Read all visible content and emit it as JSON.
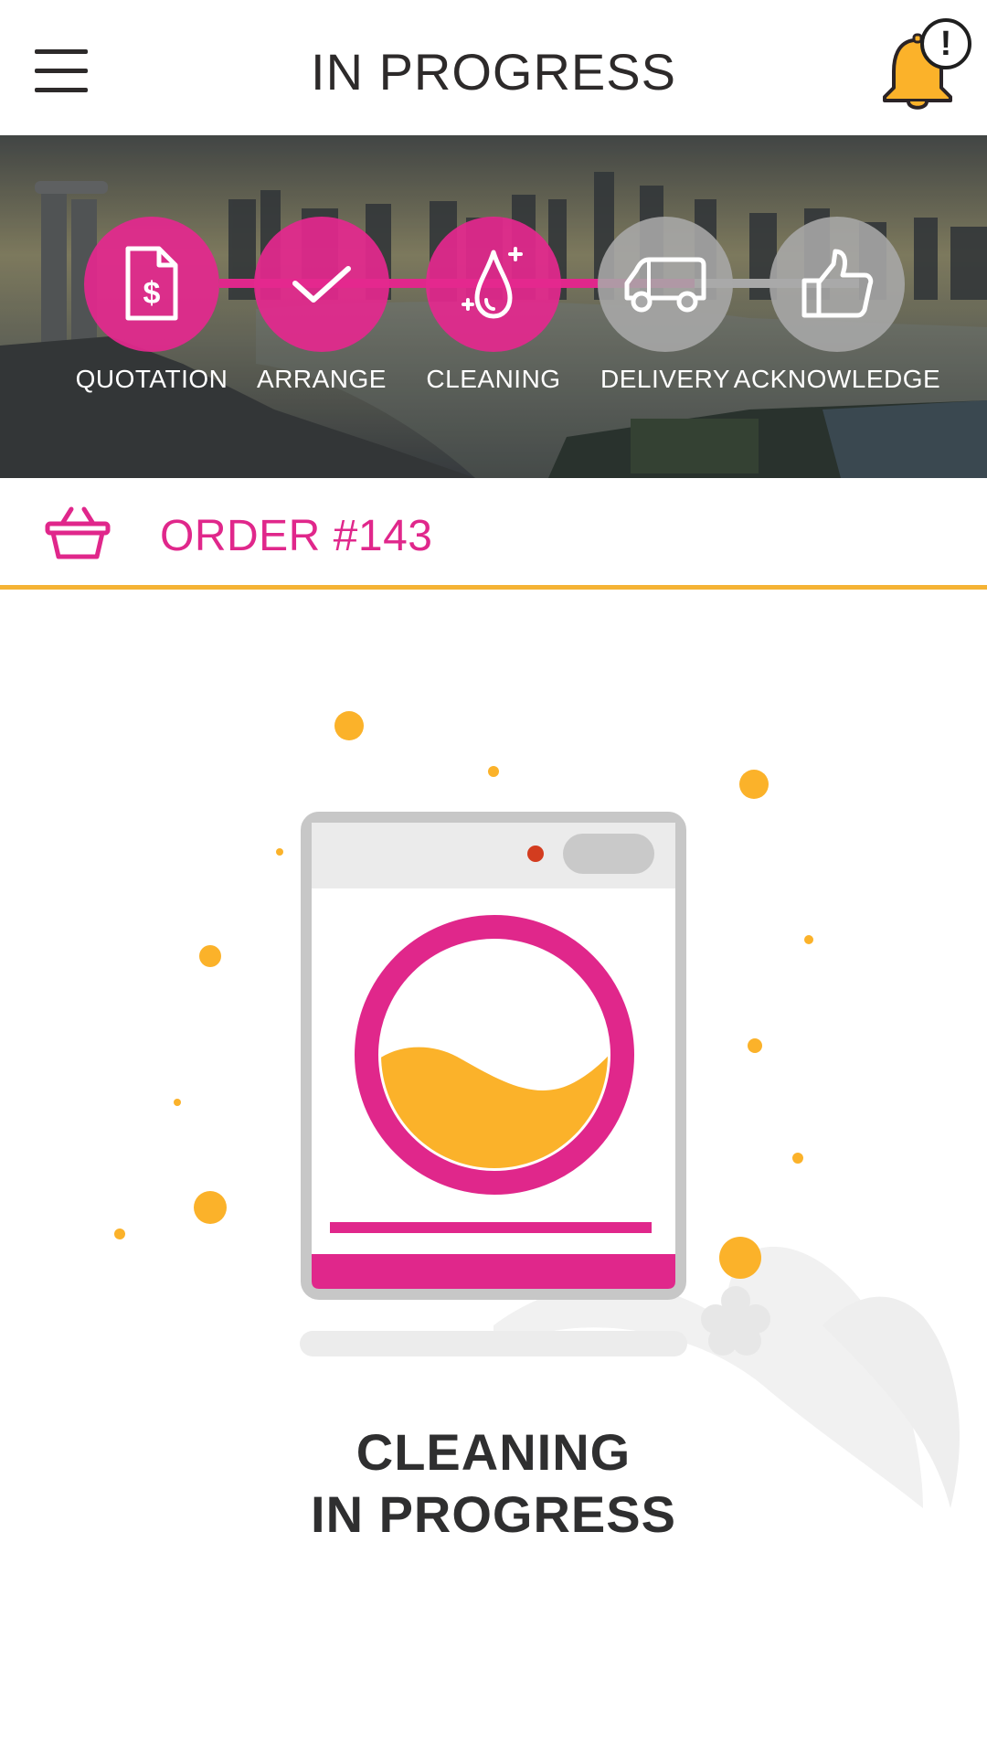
{
  "header": {
    "title": "IN PROGRESS",
    "menu_icon": "hamburger-menu-icon",
    "notification_icon": "bell-icon",
    "notification_badge": "!"
  },
  "progress_steps": [
    {
      "label": "QUOTATION",
      "icon": "dollar-document-icon",
      "status": "done"
    },
    {
      "label": "ARRANGE",
      "icon": "checkmark-icon",
      "status": "done"
    },
    {
      "label": "CLEANING",
      "icon": "water-drop-icon",
      "status": "current"
    },
    {
      "label": "DELIVERY",
      "icon": "truck-icon",
      "status": "pending"
    },
    {
      "label": "ACKNOWLEDGE",
      "icon": "thumbs-up-icon",
      "status": "pending"
    }
  ],
  "order": {
    "title": "ORDER #143",
    "icon": "basket-icon"
  },
  "status": {
    "line1": "CLEANING",
    "line2": "IN PROGRESS"
  },
  "colors": {
    "accent": "#e0278b",
    "secondary": "#fbb22a",
    "divider": "#f5b335",
    "text": "#2d2a2a"
  }
}
